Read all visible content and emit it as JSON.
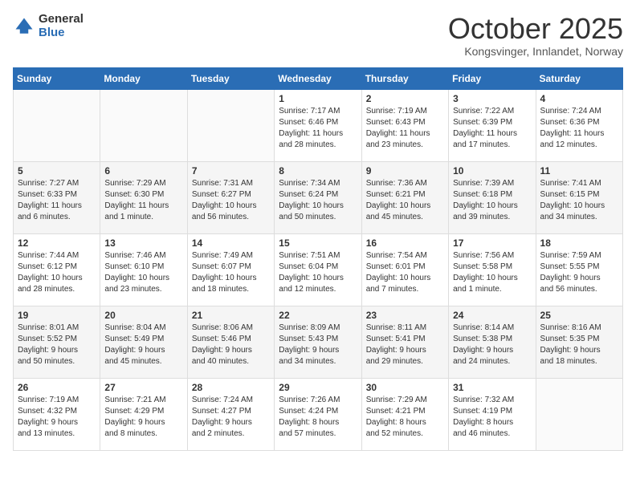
{
  "header": {
    "logo_general": "General",
    "logo_blue": "Blue",
    "month_title": "October 2025",
    "location": "Kongsvinger, Innlandet, Norway"
  },
  "weekdays": [
    "Sunday",
    "Monday",
    "Tuesday",
    "Wednesday",
    "Thursday",
    "Friday",
    "Saturday"
  ],
  "weeks": [
    [
      {
        "day": "",
        "info": ""
      },
      {
        "day": "",
        "info": ""
      },
      {
        "day": "",
        "info": ""
      },
      {
        "day": "1",
        "info": "Sunrise: 7:17 AM\nSunset: 6:46 PM\nDaylight: 11 hours\nand 28 minutes."
      },
      {
        "day": "2",
        "info": "Sunrise: 7:19 AM\nSunset: 6:43 PM\nDaylight: 11 hours\nand 23 minutes."
      },
      {
        "day": "3",
        "info": "Sunrise: 7:22 AM\nSunset: 6:39 PM\nDaylight: 11 hours\nand 17 minutes."
      },
      {
        "day": "4",
        "info": "Sunrise: 7:24 AM\nSunset: 6:36 PM\nDaylight: 11 hours\nand 12 minutes."
      }
    ],
    [
      {
        "day": "5",
        "info": "Sunrise: 7:27 AM\nSunset: 6:33 PM\nDaylight: 11 hours\nand 6 minutes."
      },
      {
        "day": "6",
        "info": "Sunrise: 7:29 AM\nSunset: 6:30 PM\nDaylight: 11 hours\nand 1 minute."
      },
      {
        "day": "7",
        "info": "Sunrise: 7:31 AM\nSunset: 6:27 PM\nDaylight: 10 hours\nand 56 minutes."
      },
      {
        "day": "8",
        "info": "Sunrise: 7:34 AM\nSunset: 6:24 PM\nDaylight: 10 hours\nand 50 minutes."
      },
      {
        "day": "9",
        "info": "Sunrise: 7:36 AM\nSunset: 6:21 PM\nDaylight: 10 hours\nand 45 minutes."
      },
      {
        "day": "10",
        "info": "Sunrise: 7:39 AM\nSunset: 6:18 PM\nDaylight: 10 hours\nand 39 minutes."
      },
      {
        "day": "11",
        "info": "Sunrise: 7:41 AM\nSunset: 6:15 PM\nDaylight: 10 hours\nand 34 minutes."
      }
    ],
    [
      {
        "day": "12",
        "info": "Sunrise: 7:44 AM\nSunset: 6:12 PM\nDaylight: 10 hours\nand 28 minutes."
      },
      {
        "day": "13",
        "info": "Sunrise: 7:46 AM\nSunset: 6:10 PM\nDaylight: 10 hours\nand 23 minutes."
      },
      {
        "day": "14",
        "info": "Sunrise: 7:49 AM\nSunset: 6:07 PM\nDaylight: 10 hours\nand 18 minutes."
      },
      {
        "day": "15",
        "info": "Sunrise: 7:51 AM\nSunset: 6:04 PM\nDaylight: 10 hours\nand 12 minutes."
      },
      {
        "day": "16",
        "info": "Sunrise: 7:54 AM\nSunset: 6:01 PM\nDaylight: 10 hours\nand 7 minutes."
      },
      {
        "day": "17",
        "info": "Sunrise: 7:56 AM\nSunset: 5:58 PM\nDaylight: 10 hours\nand 1 minute."
      },
      {
        "day": "18",
        "info": "Sunrise: 7:59 AM\nSunset: 5:55 PM\nDaylight: 9 hours\nand 56 minutes."
      }
    ],
    [
      {
        "day": "19",
        "info": "Sunrise: 8:01 AM\nSunset: 5:52 PM\nDaylight: 9 hours\nand 50 minutes."
      },
      {
        "day": "20",
        "info": "Sunrise: 8:04 AM\nSunset: 5:49 PM\nDaylight: 9 hours\nand 45 minutes."
      },
      {
        "day": "21",
        "info": "Sunrise: 8:06 AM\nSunset: 5:46 PM\nDaylight: 9 hours\nand 40 minutes."
      },
      {
        "day": "22",
        "info": "Sunrise: 8:09 AM\nSunset: 5:43 PM\nDaylight: 9 hours\nand 34 minutes."
      },
      {
        "day": "23",
        "info": "Sunrise: 8:11 AM\nSunset: 5:41 PM\nDaylight: 9 hours\nand 29 minutes."
      },
      {
        "day": "24",
        "info": "Sunrise: 8:14 AM\nSunset: 5:38 PM\nDaylight: 9 hours\nand 24 minutes."
      },
      {
        "day": "25",
        "info": "Sunrise: 8:16 AM\nSunset: 5:35 PM\nDaylight: 9 hours\nand 18 minutes."
      }
    ],
    [
      {
        "day": "26",
        "info": "Sunrise: 7:19 AM\nSunset: 4:32 PM\nDaylight: 9 hours\nand 13 minutes."
      },
      {
        "day": "27",
        "info": "Sunrise: 7:21 AM\nSunset: 4:29 PM\nDaylight: 9 hours\nand 8 minutes."
      },
      {
        "day": "28",
        "info": "Sunrise: 7:24 AM\nSunset: 4:27 PM\nDaylight: 9 hours\nand 2 minutes."
      },
      {
        "day": "29",
        "info": "Sunrise: 7:26 AM\nSunset: 4:24 PM\nDaylight: 8 hours\nand 57 minutes."
      },
      {
        "day": "30",
        "info": "Sunrise: 7:29 AM\nSunset: 4:21 PM\nDaylight: 8 hours\nand 52 minutes."
      },
      {
        "day": "31",
        "info": "Sunrise: 7:32 AM\nSunset: 4:19 PM\nDaylight: 8 hours\nand 46 minutes."
      },
      {
        "day": "",
        "info": ""
      }
    ]
  ]
}
